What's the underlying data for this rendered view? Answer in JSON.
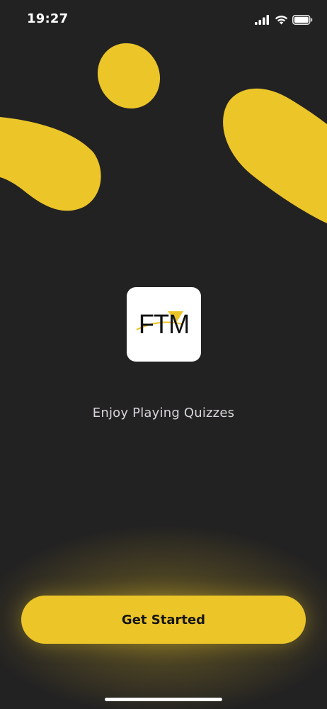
{
  "status_bar": {
    "time": "19:27",
    "icons": [
      "cellular-signal-icon",
      "wifi-icon",
      "battery-icon"
    ]
  },
  "logo": {
    "text": "FTM",
    "accent_color": "#ecc529"
  },
  "tagline": "Enjoy Playing Quizzes",
  "cta": {
    "label": "Get Started"
  },
  "colors": {
    "background": "#232222",
    "accent": "#ecc529",
    "tagline": "#d9d4dc"
  }
}
